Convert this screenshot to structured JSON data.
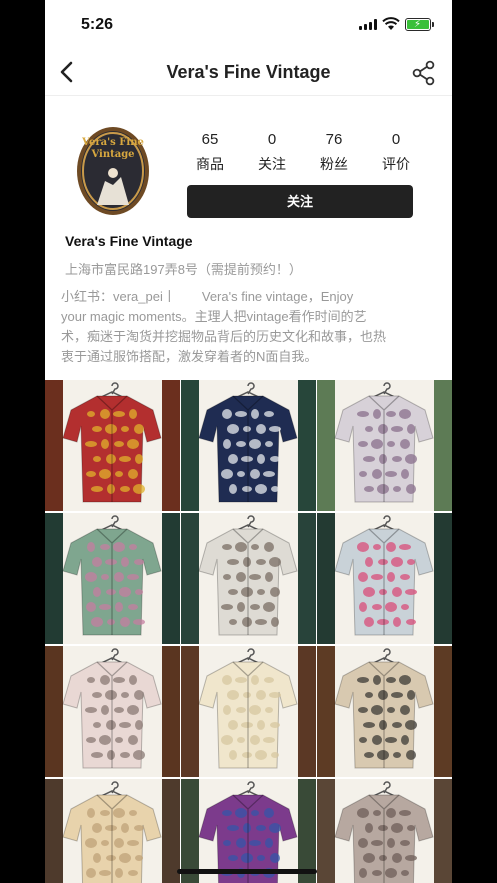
{
  "status_bar": {
    "time": "5:26"
  },
  "nav": {
    "title": "Vera's Fine Vintage"
  },
  "profile": {
    "logo_text": [
      "Vera's Fine",
      "Vintage"
    ],
    "stats": [
      {
        "value": "65",
        "label": "商品"
      },
      {
        "value": "0",
        "label": "关注"
      },
      {
        "value": "76",
        "label": "粉丝"
      },
      {
        "value": "0",
        "label": "评价"
      }
    ],
    "follow_label": "关注",
    "name": "Vera's Fine Vintage",
    "address": "上海市富民路197弄8号（需提前预约！）",
    "bio_lines": [
      "小红书：vera_pei丨　　Vera's fine vintage，Enjoy",
      "your magic moments。主理人把vintage看作时间的艺",
      "术，痴迷于淘货并挖掘物品背后的历史文化和故事，也热",
      "衷于通过服饰搭配，激发穿着者的N面自我。"
    ]
  },
  "products": [
    {
      "bg": "#6b2f1e",
      "shirt": "#b32f2f",
      "accent": "#e0b12c"
    },
    {
      "bg": "#27463a",
      "shirt": "#1f2c52",
      "accent": "#e7e9ee"
    },
    {
      "bg": "#5d7b55",
      "shirt": "#d7d1d8",
      "accent": "#8a6f8c"
    },
    {
      "bg": "#223b33",
      "shirt": "#7fa68f",
      "accent": "#c47ea0"
    },
    {
      "bg": "#28433a",
      "shirt": "#dedbd4",
      "accent": "#7a6d64"
    },
    {
      "bg": "#233a32",
      "shirt": "#c9d2d8",
      "accent": "#d84c7a"
    },
    {
      "bg": "#5a3520",
      "shirt": "#e9d8d4",
      "accent": "#8a7a74"
    },
    {
      "bg": "#5b3825",
      "shirt": "#f0e6cc",
      "accent": "#d7c7a0"
    },
    {
      "bg": "#5d3b24",
      "shirt": "#d8c9b0",
      "accent": "#3c3a36"
    },
    {
      "bg": "#4e3a2c",
      "shirt": "#e8d3ac",
      "accent": "#bfa278"
    },
    {
      "bg": "#394a37",
      "shirt": "#7c3b8c",
      "accent": "#3555a8"
    },
    {
      "bg": "#5a4636",
      "shirt": "#b7a8a0",
      "accent": "#6d5d58"
    }
  ]
}
